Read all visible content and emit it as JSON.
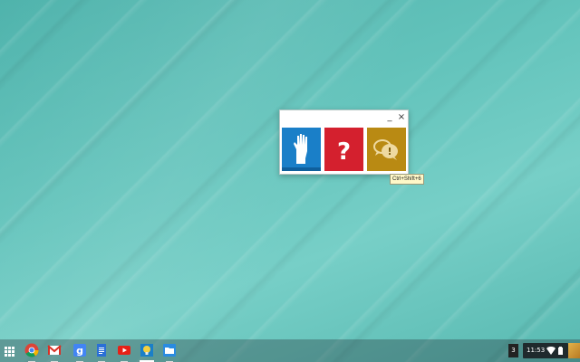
{
  "window": {
    "minimize_glyph": "_",
    "close_glyph": "×",
    "tiles": [
      {
        "name": "hand-raise-icon",
        "color": "#1a7fc8"
      },
      {
        "name": "question-mark-icon",
        "color": "#d4202e",
        "glyph": "?"
      },
      {
        "name": "feedback-chat-icon",
        "color": "#b98a13",
        "glyph": "!"
      }
    ]
  },
  "tooltip": {
    "text": "Ctrl+Shift+6"
  },
  "shelf": {
    "apps": [
      {
        "name": "chrome-icon"
      },
      {
        "name": "gmail-icon"
      },
      {
        "name": "google-search-icon",
        "glyph": "g"
      },
      {
        "name": "docs-icon"
      },
      {
        "name": "youtube-icon"
      },
      {
        "name": "bulb-app-icon",
        "active": true
      },
      {
        "name": "files-icon"
      }
    ]
  },
  "status": {
    "notification_count": "3",
    "time": "11:53"
  }
}
